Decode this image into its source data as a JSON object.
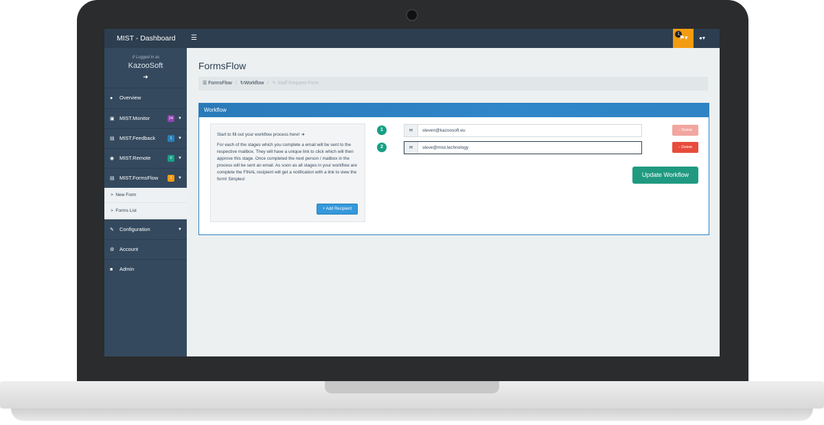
{
  "topbar": {
    "brand": "MIST - Dashboard",
    "menu_icon": "☰",
    "notification_count": "1",
    "bell_icon": "bell-icon",
    "user_icon": "user-icon"
  },
  "sidebar": {
    "logged_in_label": "Logged in as",
    "company": "KazooSoft",
    "items": [
      {
        "label": "Overview",
        "icon": "dashboard-icon"
      },
      {
        "label": "MIST.Monitor",
        "badge": "24",
        "badge_color": "#8e44ad",
        "icon": "monitor-icon"
      },
      {
        "label": "MIST.Feedback",
        "badge": "1",
        "badge_color": "#2980b9",
        "icon": "feedback-icon"
      },
      {
        "label": "MIST.Remote",
        "badge": "0",
        "badge_color": "#16a085",
        "icon": "users-icon"
      },
      {
        "label": "MIST.FormsFlow",
        "badge": "1",
        "badge_color": "#f39c12",
        "icon": "forms-icon"
      },
      {
        "label": "Configuration",
        "icon": "edit-icon"
      },
      {
        "label": "Account",
        "icon": "gear-icon"
      },
      {
        "label": "Admin",
        "icon": "lock-icon"
      }
    ],
    "submenu": [
      {
        "label": "New Form"
      },
      {
        "label": "Forms List"
      }
    ]
  },
  "main": {
    "title": "FormsFlow",
    "breadcrumb": [
      "FormsFlow",
      "Workflow",
      "Staff Request Form"
    ],
    "panel_title": "Workflow",
    "info": {
      "title": "Start to fill out your workflow process here!",
      "body": "For each of the stages which you complete a email will be sent to the respective mailbox. They will have a unique link to click which will then approve this stage. Once completed the next person / mailbox in the process will be sent an email. As soon as all stages in your workflow are complete the FINAL recipient will get a notification with a link to view the form! Simples!",
      "add_button": "+ Add Recipient"
    },
    "recipients": [
      {
        "step": "1",
        "email": "steven@kazoosoft.eu",
        "delete_label": "− Delete"
      },
      {
        "step": "2",
        "email": "steve@mist.technology",
        "delete_label": "− Delete"
      }
    ],
    "update_button": "Update Workflow"
  },
  "colors": {
    "nav": "#2c3e50",
    "sidebar": "#34495e",
    "primary": "#2f80c0",
    "success": "#1f9a80",
    "danger": "#e74c3c",
    "warning": "#f39c12"
  }
}
